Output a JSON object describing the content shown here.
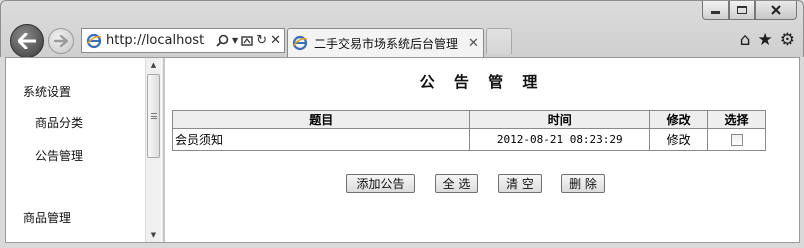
{
  "browser": {
    "url": "http://localhost",
    "tab_title": "二手交易市场系统后台管理",
    "window_controls": [
      "minimize-icon",
      "maximize-icon",
      "close-icon"
    ],
    "toolbar_icons": [
      "home-icon",
      "star-icon",
      "gear-icon"
    ]
  },
  "sidebar": {
    "items": [
      {
        "label": "系统设置"
      },
      {
        "label": "商品分类"
      },
      {
        "label": "公告管理"
      },
      {
        "label": "商品管理"
      }
    ]
  },
  "main": {
    "title": "公 告 管 理",
    "table": {
      "headers": [
        "题目",
        "时间",
        "修改",
        "选择"
      ],
      "rows": [
        {
          "title": "会员须知",
          "time": "2012-08-21 08:23:29",
          "edit": "修改",
          "checked": false
        }
      ]
    },
    "buttons": {
      "add": "添加公告",
      "select_all": "全 选",
      "clear": "清 空",
      "delete": "删 除"
    }
  }
}
